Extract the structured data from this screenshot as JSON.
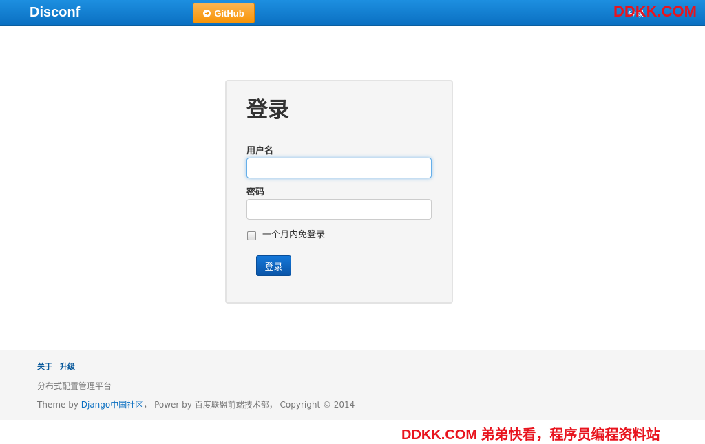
{
  "navbar": {
    "brand": "Disconf",
    "github_label": "GitHub",
    "login_link": "登录",
    "background": "#0a6fc1"
  },
  "watermark": {
    "top": "DDKK.COM",
    "bottom": "DDKK.COM 弟弟快看，程序员编程资料站",
    "color": "#e8141e"
  },
  "login": {
    "title": "登录",
    "username_label": "用户名",
    "username_value": "",
    "password_label": "密码",
    "password_value": "",
    "remember_label": "一个月内免登录",
    "remember_checked": false,
    "submit_label": "登录",
    "button_color": "#0a55a8"
  },
  "footer": {
    "links": [
      "关于",
      "升级"
    ],
    "description": "分布式配置管理平台",
    "credits": {
      "prefix": "Theme by ",
      "django": "Django中国社区",
      "suffix": "， Power by 百度联盟前端技术部， Copyright © 2014"
    }
  },
  "icons": {
    "github": "github-icon",
    "checkbox": "checkbox-icon"
  }
}
